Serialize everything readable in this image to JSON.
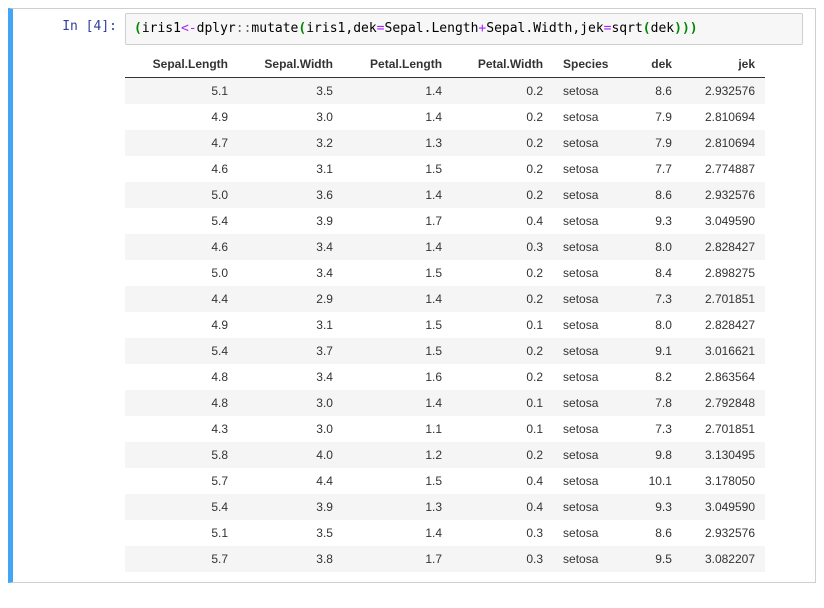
{
  "cell": {
    "prompt_label": "In",
    "prompt_count": "4",
    "code_tokens": [
      {
        "t": "(",
        "c": "tok-paren"
      },
      {
        "t": "iris1",
        "c": "tok-name"
      },
      {
        "t": "<-",
        "c": "tok-op"
      },
      {
        "t": "dplyr",
        "c": "tok-ns"
      },
      {
        "t": "::",
        "c": "tok-dcolon"
      },
      {
        "t": "mutate",
        "c": "tok-func"
      },
      {
        "t": "(",
        "c": "tok-paren"
      },
      {
        "t": "iris1",
        "c": "tok-name"
      },
      {
        "t": ",",
        "c": "tok-name"
      },
      {
        "t": "dek",
        "c": "tok-name"
      },
      {
        "t": "=",
        "c": "tok-op"
      },
      {
        "t": "Sepal.Length",
        "c": "tok-name"
      },
      {
        "t": "+",
        "c": "tok-op"
      },
      {
        "t": "Sepal.Width",
        "c": "tok-name"
      },
      {
        "t": ",",
        "c": "tok-name"
      },
      {
        "t": "jek",
        "c": "tok-name"
      },
      {
        "t": "=",
        "c": "tok-op"
      },
      {
        "t": "sqrt",
        "c": "tok-func"
      },
      {
        "t": "(",
        "c": "tok-paren"
      },
      {
        "t": "dek",
        "c": "tok-name"
      },
      {
        "t": ")",
        "c": "tok-paren"
      },
      {
        "t": ")",
        "c": "tok-paren"
      },
      {
        "t": ")",
        "c": "tok-paren"
      }
    ]
  },
  "table": {
    "columns": [
      "Sepal.Length",
      "Sepal.Width",
      "Petal.Length",
      "Petal.Width",
      "Species",
      "dek",
      "jek"
    ],
    "rows": [
      {
        "Sepal.Length": "5.1",
        "Sepal.Width": "3.5",
        "Petal.Length": "1.4",
        "Petal.Width": "0.2",
        "Species": "setosa",
        "dek": "8.6",
        "jek": "2.932576"
      },
      {
        "Sepal.Length": "4.9",
        "Sepal.Width": "3.0",
        "Petal.Length": "1.4",
        "Petal.Width": "0.2",
        "Species": "setosa",
        "dek": "7.9",
        "jek": "2.810694"
      },
      {
        "Sepal.Length": "4.7",
        "Sepal.Width": "3.2",
        "Petal.Length": "1.3",
        "Petal.Width": "0.2",
        "Species": "setosa",
        "dek": "7.9",
        "jek": "2.810694"
      },
      {
        "Sepal.Length": "4.6",
        "Sepal.Width": "3.1",
        "Petal.Length": "1.5",
        "Petal.Width": "0.2",
        "Species": "setosa",
        "dek": "7.7",
        "jek": "2.774887"
      },
      {
        "Sepal.Length": "5.0",
        "Sepal.Width": "3.6",
        "Petal.Length": "1.4",
        "Petal.Width": "0.2",
        "Species": "setosa",
        "dek": "8.6",
        "jek": "2.932576"
      },
      {
        "Sepal.Length": "5.4",
        "Sepal.Width": "3.9",
        "Petal.Length": "1.7",
        "Petal.Width": "0.4",
        "Species": "setosa",
        "dek": "9.3",
        "jek": "3.049590"
      },
      {
        "Sepal.Length": "4.6",
        "Sepal.Width": "3.4",
        "Petal.Length": "1.4",
        "Petal.Width": "0.3",
        "Species": "setosa",
        "dek": "8.0",
        "jek": "2.828427"
      },
      {
        "Sepal.Length": "5.0",
        "Sepal.Width": "3.4",
        "Petal.Length": "1.5",
        "Petal.Width": "0.2",
        "Species": "setosa",
        "dek": "8.4",
        "jek": "2.898275"
      },
      {
        "Sepal.Length": "4.4",
        "Sepal.Width": "2.9",
        "Petal.Length": "1.4",
        "Petal.Width": "0.2",
        "Species": "setosa",
        "dek": "7.3",
        "jek": "2.701851"
      },
      {
        "Sepal.Length": "4.9",
        "Sepal.Width": "3.1",
        "Petal.Length": "1.5",
        "Petal.Width": "0.1",
        "Species": "setosa",
        "dek": "8.0",
        "jek": "2.828427"
      },
      {
        "Sepal.Length": "5.4",
        "Sepal.Width": "3.7",
        "Petal.Length": "1.5",
        "Petal.Width": "0.2",
        "Species": "setosa",
        "dek": "9.1",
        "jek": "3.016621"
      },
      {
        "Sepal.Length": "4.8",
        "Sepal.Width": "3.4",
        "Petal.Length": "1.6",
        "Petal.Width": "0.2",
        "Species": "setosa",
        "dek": "8.2",
        "jek": "2.863564"
      },
      {
        "Sepal.Length": "4.8",
        "Sepal.Width": "3.0",
        "Petal.Length": "1.4",
        "Petal.Width": "0.1",
        "Species": "setosa",
        "dek": "7.8",
        "jek": "2.792848"
      },
      {
        "Sepal.Length": "4.3",
        "Sepal.Width": "3.0",
        "Petal.Length": "1.1",
        "Petal.Width": "0.1",
        "Species": "setosa",
        "dek": "7.3",
        "jek": "2.701851"
      },
      {
        "Sepal.Length": "5.8",
        "Sepal.Width": "4.0",
        "Petal.Length": "1.2",
        "Petal.Width": "0.2",
        "Species": "setosa",
        "dek": "9.8",
        "jek": "3.130495"
      },
      {
        "Sepal.Length": "5.7",
        "Sepal.Width": "4.4",
        "Petal.Length": "1.5",
        "Petal.Width": "0.4",
        "Species": "setosa",
        "dek": "10.1",
        "jek": "3.178050"
      },
      {
        "Sepal.Length": "5.4",
        "Sepal.Width": "3.9",
        "Petal.Length": "1.3",
        "Petal.Width": "0.4",
        "Species": "setosa",
        "dek": "9.3",
        "jek": "3.049590"
      },
      {
        "Sepal.Length": "5.1",
        "Sepal.Width": "3.5",
        "Petal.Length": "1.4",
        "Petal.Width": "0.3",
        "Species": "setosa",
        "dek": "8.6",
        "jek": "2.932576"
      },
      {
        "Sepal.Length": "5.7",
        "Sepal.Width": "3.8",
        "Petal.Length": "1.7",
        "Petal.Width": "0.3",
        "Species": "setosa",
        "dek": "9.5",
        "jek": "3.082207"
      }
    ]
  }
}
